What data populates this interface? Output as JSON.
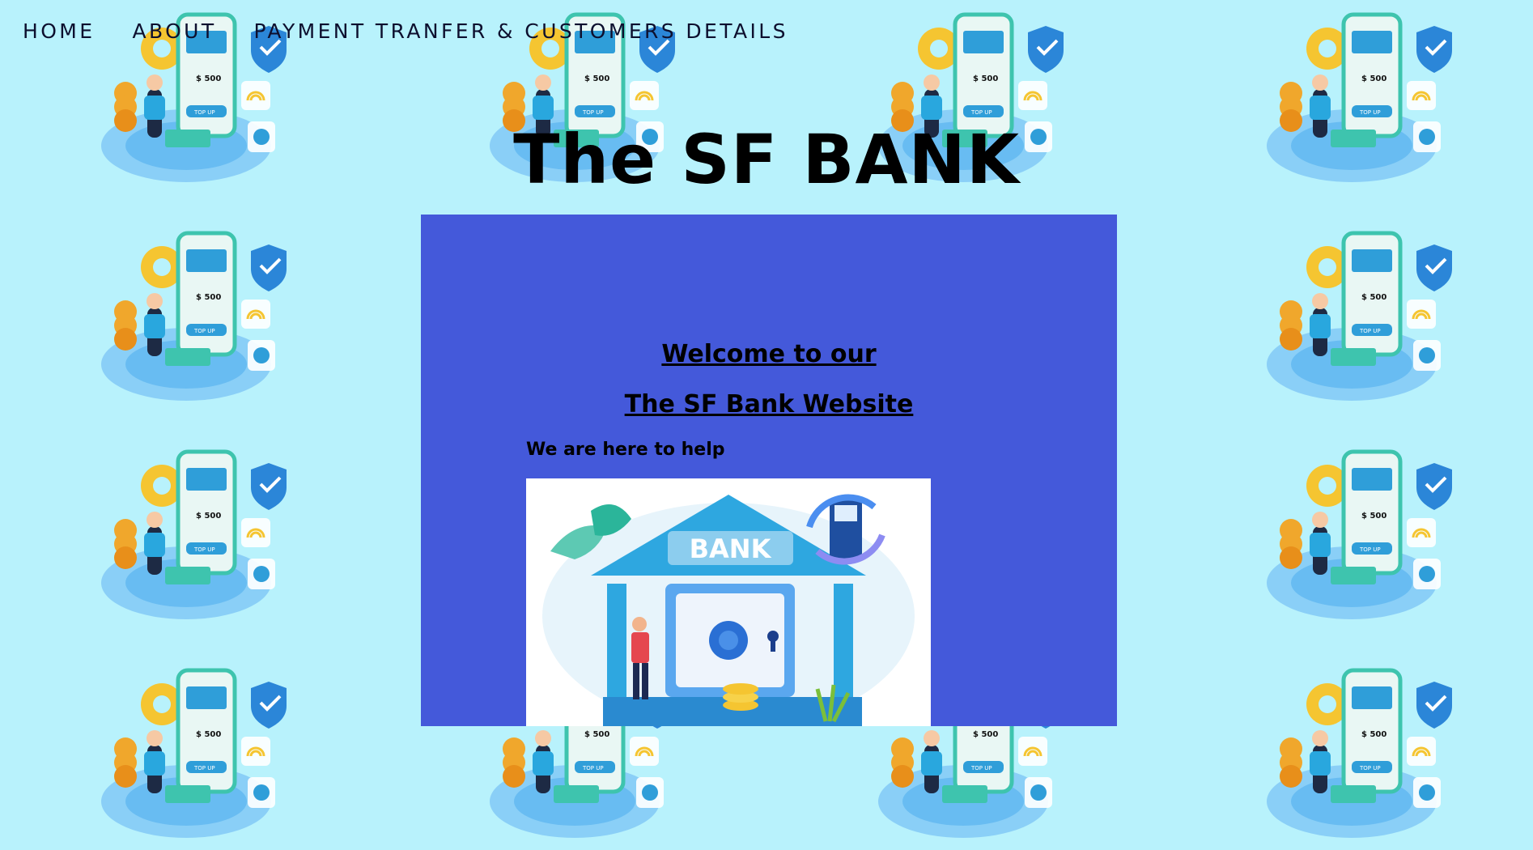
{
  "nav": {
    "items": [
      {
        "label": "HOME"
      },
      {
        "label": "ABOUT"
      },
      {
        "label": "PAYMENT TRANFER & CUSTOMERS DETAILS"
      }
    ]
  },
  "header": {
    "title": "The SF BANK"
  },
  "main": {
    "welcome_line1": "Welcome to our",
    "welcome_line2": "The SF Bank Website",
    "help_text": "We are here to help",
    "illustration": {
      "sign_text": "BANK",
      "icon": "bank-vault-illustration"
    }
  },
  "background_tile": {
    "amount_text": "$ 500",
    "button_text": "TOP UP",
    "icon": "mobile-payment-illustration"
  },
  "colors": {
    "page_bg": "#b8f2fc",
    "panel_bg": "#4459da",
    "text": "#000000"
  }
}
